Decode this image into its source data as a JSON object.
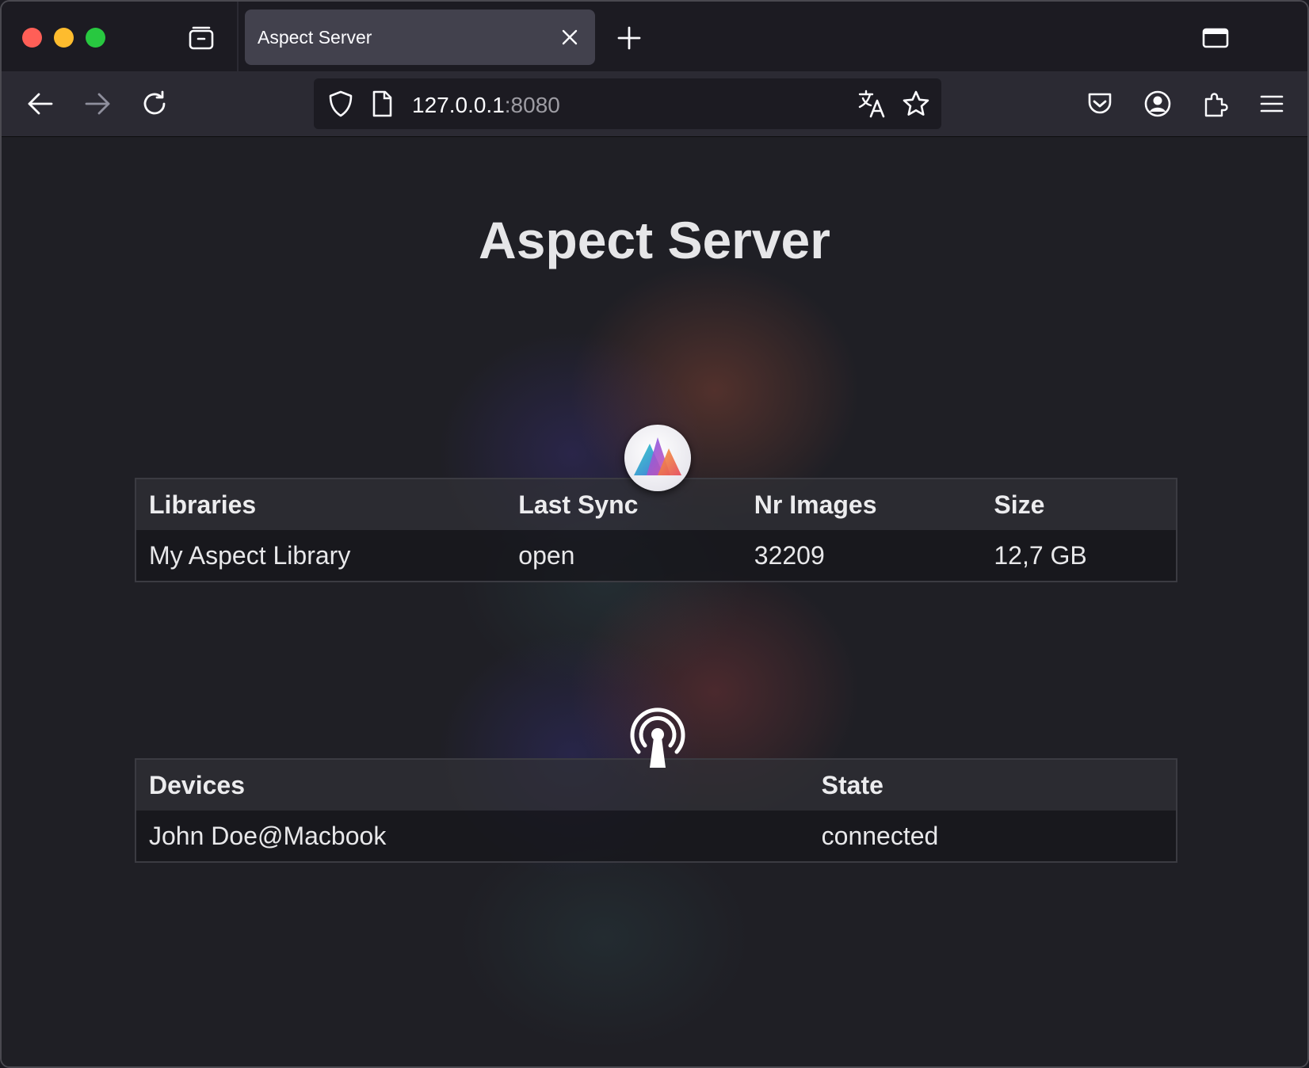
{
  "browser": {
    "tab_title": "Aspect Server",
    "url_host": "127.0.0.1",
    "url_port": ":8080",
    "icons": {
      "tab_overview": "tab-overview-icon",
      "tab_close": "close-icon",
      "new_tab": "plus-icon",
      "tab_list": "tab-list-icon",
      "back": "back-arrow-icon",
      "forward": "forward-arrow-icon",
      "reload": "reload-icon",
      "shield": "shield-icon",
      "page": "page-icon",
      "translate": "translate-icon",
      "bookmark": "star-icon",
      "pocket": "pocket-icon",
      "account": "account-icon",
      "extensions": "puzzle-icon",
      "menu": "hamburger-menu-icon"
    }
  },
  "page": {
    "title": "Aspect Server",
    "libraries": {
      "headers": [
        "Libraries",
        "Last Sync",
        "Nr Images",
        "Size"
      ],
      "rows": [
        [
          "My Aspect Library",
          "open",
          "32209",
          "12,7 GB"
        ]
      ]
    },
    "devices": {
      "headers": [
        "Devices",
        "State"
      ],
      "rows": [
        [
          "John Doe@Macbook",
          "connected"
        ]
      ]
    }
  },
  "colors": {
    "traffic_red": "#ff5f57",
    "traffic_yellow": "#febc2e",
    "traffic_green": "#28c840",
    "tab_active": "#42414d",
    "toolbar": "#2b2a33",
    "urlbar": "#1c1b22"
  }
}
